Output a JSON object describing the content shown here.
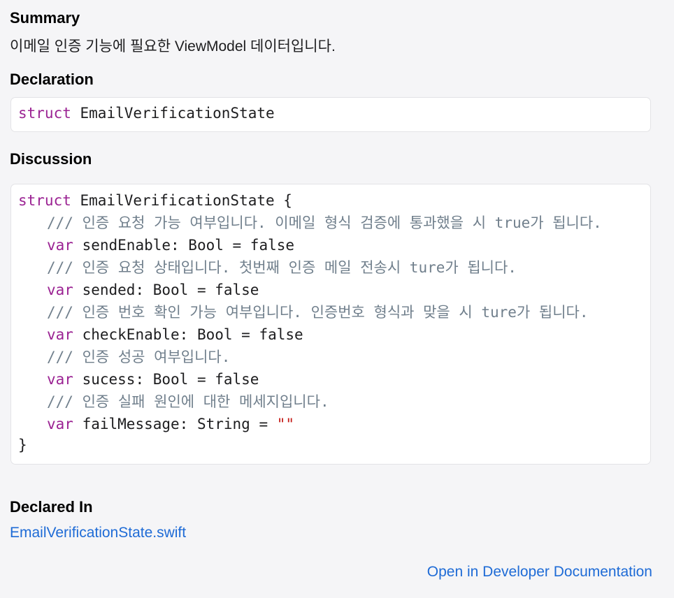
{
  "summary": {
    "title": "Summary",
    "text": "이메일 인증 기능에 필요한 ViewModel 데이터입니다."
  },
  "declaration": {
    "title": "Declaration",
    "keyword": "struct",
    "name": "EmailVerificationState"
  },
  "discussion": {
    "title": "Discussion",
    "header_keyword": "struct",
    "header_rest": " EmailVerificationState {",
    "comments": [
      "/// 인증 요청 가능 여부입니다. 이메일 형식 검증에 통과했을 시 true가 됩니다.",
      "/// 인증 요청 상태입니다. 첫번째 인증 메일 전송시 ture가 됩니다.",
      "/// 인증 번호 확인 가능 여부입니다. 인증번호 형식과 맞을 시 ture가 됩니다.",
      "/// 인증 성공 여부입니다.",
      "/// 인증 실패 원인에 대한 메세지입니다."
    ],
    "var_keyword": "var",
    "vars": [
      " sendEnable: Bool = false",
      " sended: Bool = false",
      " checkEnable: Bool = false",
      " sucess: Bool = false",
      " failMessage: String = "
    ],
    "string_literal": "\"\"",
    "closing": "}"
  },
  "declared_in": {
    "title": "Declared In",
    "file_link": "EmailVerificationState.swift"
  },
  "footer": {
    "open_docs_link": "Open in Developer Documentation"
  },
  "colors": {
    "keyword": "#9b2393",
    "comment": "#707f8c",
    "string": "#c41a16",
    "link": "#1e6bd6"
  }
}
